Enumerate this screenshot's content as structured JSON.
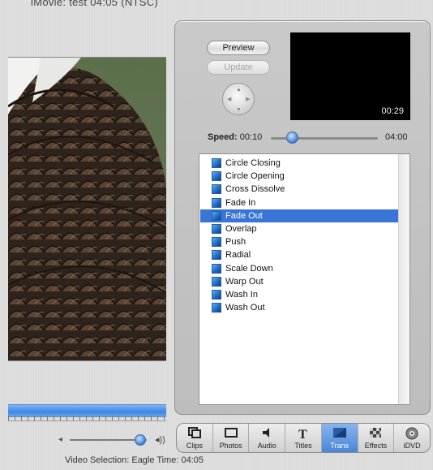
{
  "window": {
    "title": "iMovie: test  04:05 (NTSC)"
  },
  "editor": {
    "preview_label": "Preview",
    "update_label": "Update",
    "preview_time": "00:29",
    "speed_label": "Speed:",
    "speed_min": "00:10",
    "speed_max": "04:00",
    "speed_value_fraction": 0.2
  },
  "transitions": {
    "selected": "Fade Out",
    "items": [
      "Circle Closing",
      "Circle Opening",
      "Cross Dissolve",
      "Fade In",
      "Fade Out",
      "Overlap",
      "Push",
      "Radial",
      "Scale Down",
      "Warp Out",
      "Wash In",
      "Wash Out"
    ]
  },
  "toolbar": {
    "active": "Trans",
    "buttons": [
      {
        "label": "Clips",
        "icon": "clips-icon"
      },
      {
        "label": "Photos",
        "icon": "photos-icon"
      },
      {
        "label": "Audio",
        "icon": "audio-icon"
      },
      {
        "label": "Titles",
        "icon": "titles-icon"
      },
      {
        "label": "Trans",
        "icon": "transitions-icon"
      },
      {
        "label": "Effects",
        "icon": "effects-icon"
      },
      {
        "label": "iDVD",
        "icon": "idvd-icon"
      }
    ]
  },
  "status": {
    "text": "Video Selection: Eagle Time: 04:05"
  },
  "volume": {
    "level_fraction": 0.92
  },
  "colors": {
    "selection": "#3875d7",
    "accent": "#3d86e8",
    "preview_bg": "#000000"
  }
}
